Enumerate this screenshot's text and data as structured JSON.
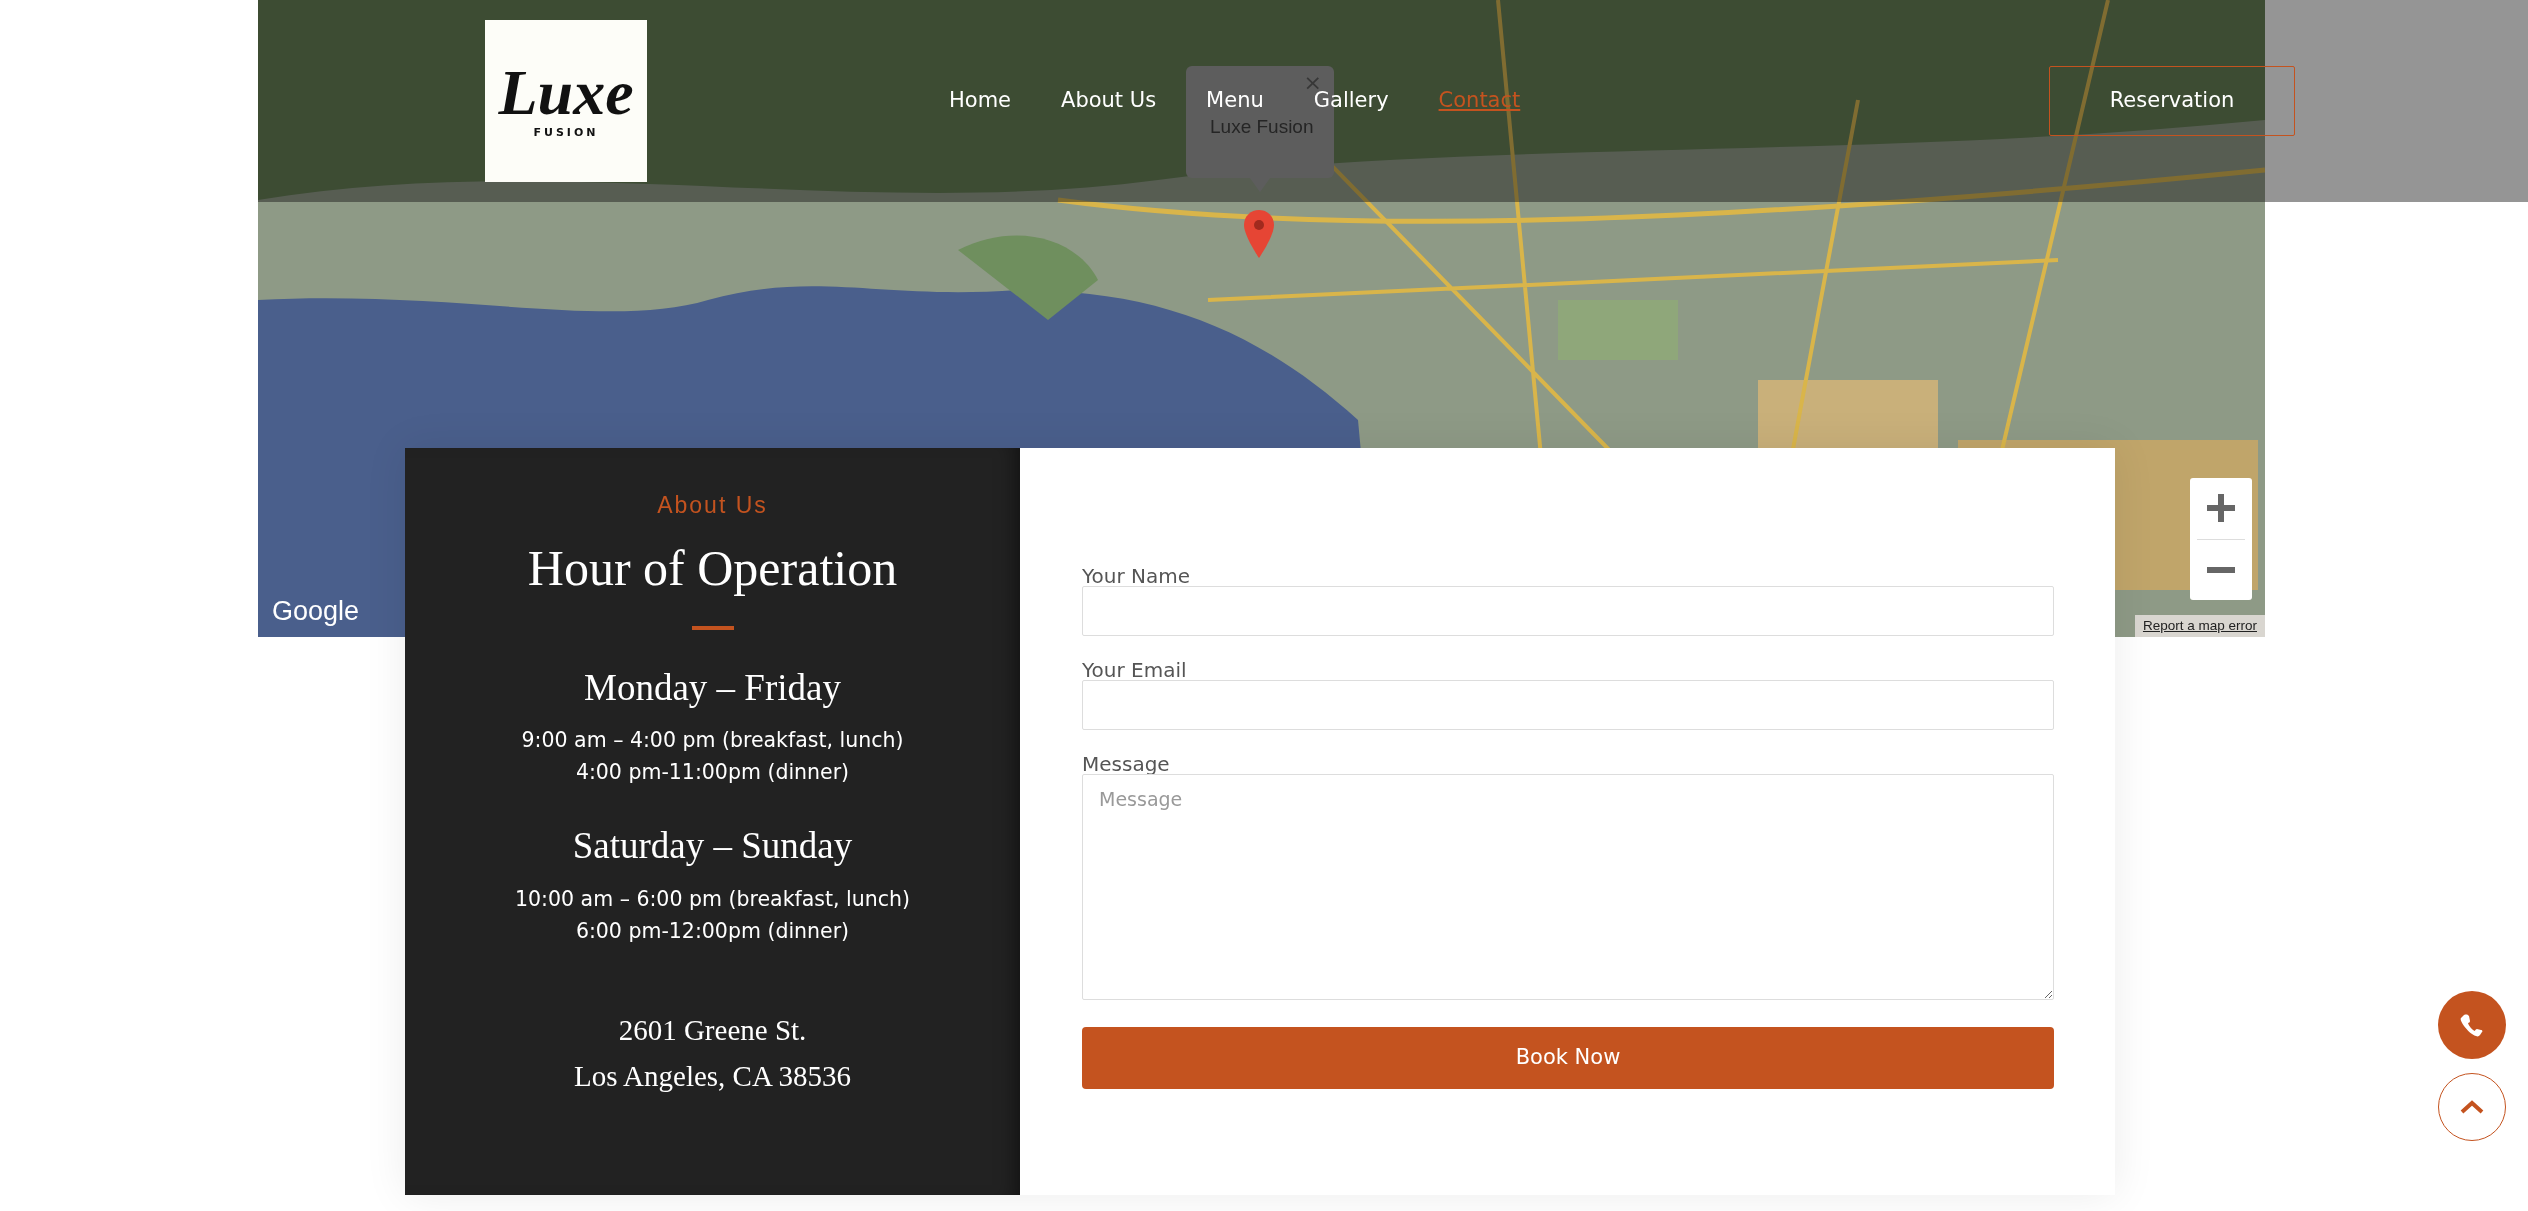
{
  "header": {
    "logo": {
      "script": "Luxe",
      "sub": "FUSION"
    },
    "nav": [
      {
        "label": "Home",
        "selected": false
      },
      {
        "label": "About Us",
        "selected": false
      },
      {
        "label": "Menu",
        "selected": false
      },
      {
        "label": "Gallery",
        "selected": false
      },
      {
        "label": "Contact",
        "selected": true
      }
    ],
    "action": "Reservation"
  },
  "map": {
    "kind": "picture",
    "popup": {
      "title": "Luxe Fusion",
      "close": "×"
    },
    "attribution": "Google",
    "report": "Report a map error"
  },
  "hours": {
    "eyebrow": "About Us",
    "title": "Hour of Operation",
    "groups": [
      {
        "days": "Monday – Friday",
        "lines": [
          "9:00 am – 4:00 pm (breakfast, lunch)",
          "4:00 pm-11:00pm (dinner)"
        ]
      },
      {
        "days": "Saturday – Sunday",
        "lines": [
          "10:00 am – 6:00 pm (breakfast, lunch)",
          "6:00 pm-12:00pm (dinner)"
        ]
      }
    ],
    "address": [
      "2601 Greene St.",
      "Los Angeles, CA 38536"
    ]
  },
  "form": {
    "fields": [
      {
        "kind": "input",
        "label": "Your Name"
      },
      {
        "kind": "input",
        "label": "Your Email"
      },
      {
        "kind": "textarea",
        "label": "Message",
        "placeholder": "Message"
      }
    ],
    "submit": "Book Now"
  }
}
